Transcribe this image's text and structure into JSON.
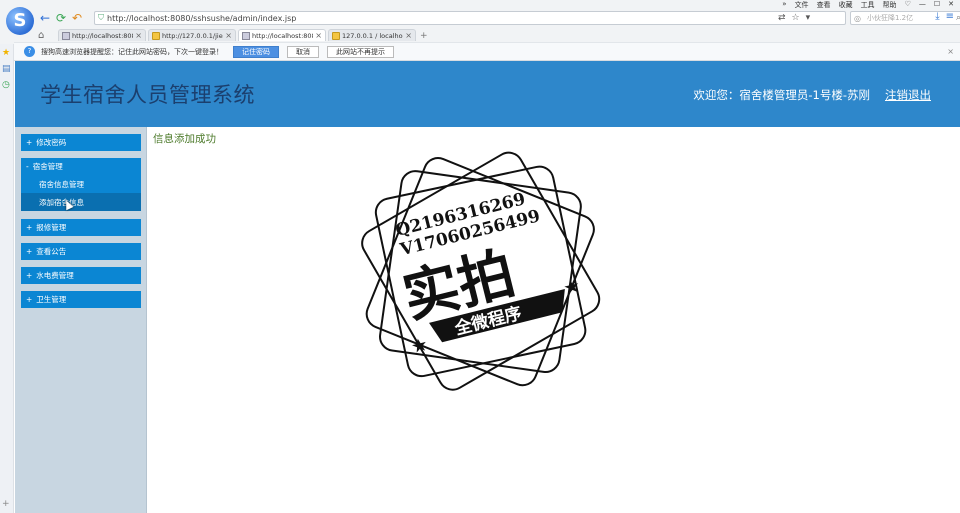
{
  "browser": {
    "menu": [
      "文件",
      "查看",
      "收藏",
      "工具",
      "帮助"
    ],
    "address": "http://localhost:8080/sshsushe/admin/index.jsp",
    "search_placeholder": "小伙狂降1.2亿",
    "tabs": [
      {
        "label": "http://localhost:8080/",
        "active": false
      },
      {
        "label": "http://127.0.0.1/jiemian",
        "active": false
      },
      {
        "label": "http://localhost:8080/",
        "active": true
      },
      {
        "label": "127.0.0.1 / localhost /",
        "active": false
      }
    ],
    "password_bar": {
      "message": "搜狗高速浏览器提醒您：记住此网站密码，下次一键登录！",
      "remember": "记住密码",
      "cancel": "取消",
      "never": "此网站不再提示"
    }
  },
  "app": {
    "title": "学生宿舍人员管理系统",
    "welcome": "欢迎您：宿舍楼管理员-1号楼-苏刚",
    "logout": "注销退出"
  },
  "sidebar": {
    "change_password": "修改密码",
    "dorm_group": {
      "label": "宿舍管理",
      "items": [
        "宿舍信息管理",
        "添加宿舍信息"
      ]
    },
    "repair": "报修管理",
    "notice": "查看公告",
    "utilities": "水电费管理",
    "hygiene": "卫生管理"
  },
  "main": {
    "status": "信息添加成功"
  },
  "watermark": {
    "line1": "Q2196316269",
    "line2": "V17060256499",
    "big": "实拍",
    "banner": "全微程序"
  }
}
